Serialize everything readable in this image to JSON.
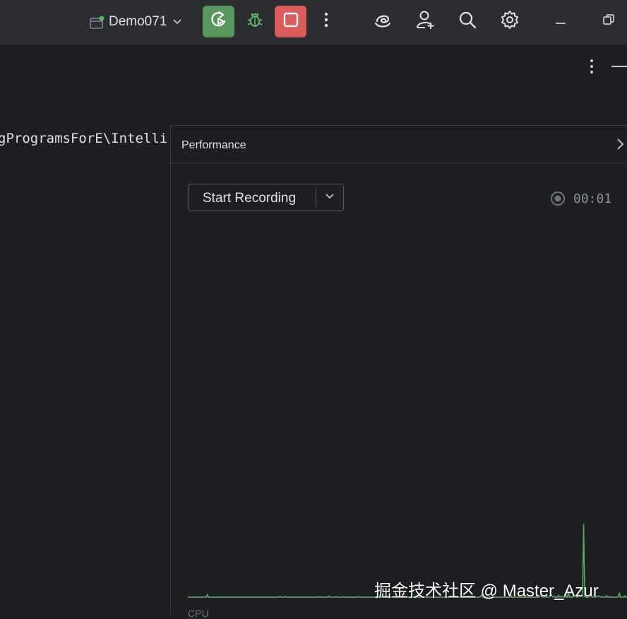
{
  "toolbar": {
    "project_name": "Demo071",
    "run_button": "run-icon",
    "debug_button": "debug-icon",
    "stop_button": "stop-icon",
    "more_button": "more-vertical-icon",
    "ai_assistant_button": "ai-assistant-icon",
    "add_user_button": "add-user-icon",
    "search_button": "search-icon",
    "settings_button": "gear-icon",
    "colors": {
      "bar_bg": "#2b2d30",
      "run_bg": "#57965c",
      "stop_bg": "#db5c5c",
      "debug_color": "#5fb865"
    }
  },
  "editor": {
    "path_text": "gProgramsForE\\Intelli"
  },
  "performance": {
    "title": "Performance",
    "record_button": "Start Recording",
    "timer": "00:01",
    "cpu_label": "CPU"
  },
  "chart_data": {
    "type": "area",
    "series": [
      {
        "name": "CPU",
        "values": [
          1,
          1,
          1,
          1,
          1,
          1,
          1,
          1,
          1,
          1,
          1,
          1,
          1,
          1,
          1,
          1,
          1,
          1,
          5,
          1,
          1,
          1,
          1,
          1,
          1,
          1,
          1,
          1,
          1,
          1,
          1,
          1,
          1,
          1,
          1,
          1,
          1,
          1,
          1,
          1,
          1,
          1,
          1,
          1,
          1,
          1,
          1,
          1,
          1,
          1,
          1,
          1,
          1,
          1,
          1,
          1,
          1,
          1,
          1,
          1,
          1,
          1,
          1,
          1,
          1,
          1,
          1,
          1,
          1,
          1,
          1,
          1,
          1,
          1,
          1,
          1,
          1,
          1,
          1,
          1,
          1,
          1,
          1,
          1,
          1,
          2,
          1,
          1,
          1,
          1,
          2,
          1,
          1,
          1,
          1,
          1,
          1,
          1,
          1,
          1,
          1,
          1,
          1,
          1,
          1,
          1,
          1,
          1,
          1,
          1,
          1,
          1,
          1,
          1,
          1,
          1,
          1,
          1,
          1,
          1,
          1,
          1,
          2,
          1,
          1,
          1,
          1,
          1,
          1,
          1,
          3,
          1,
          1,
          1,
          1,
          1,
          1,
          2,
          1,
          1,
          1,
          1,
          1,
          1,
          2,
          1,
          1,
          1,
          1,
          1,
          1,
          1,
          1,
          1,
          1,
          1,
          1,
          2,
          1,
          1,
          1,
          1,
          1,
          1,
          1,
          1,
          1,
          1,
          1,
          1,
          1,
          1,
          1,
          1,
          1,
          1,
          1,
          1,
          1,
          2,
          1,
          1,
          1,
          1,
          1,
          1,
          1,
          1,
          1,
          1,
          1,
          1,
          1,
          1,
          1,
          1,
          1,
          1,
          1,
          1,
          1,
          1,
          1,
          1,
          1,
          1,
          1,
          1,
          1,
          1,
          1,
          1,
          1,
          1,
          1,
          1,
          1,
          1,
          1,
          1,
          1,
          2,
          1,
          1,
          1,
          1,
          1,
          1,
          1,
          1,
          1,
          1,
          1,
          1,
          1,
          1,
          1,
          1,
          1,
          1,
          1,
          1,
          1,
          1,
          1,
          1,
          1,
          1,
          1,
          1,
          1,
          1,
          2,
          1,
          1,
          1,
          1,
          1,
          1,
          1,
          1,
          1,
          1,
          1,
          1,
          1,
          1,
          1,
          1,
          1,
          2,
          5,
          1,
          1,
          1,
          1,
          1,
          1,
          1,
          1,
          1,
          2,
          1,
          1,
          1,
          1,
          1,
          1,
          1,
          1,
          1,
          1,
          1,
          1,
          1,
          1,
          1,
          1,
          4,
          1,
          1,
          1,
          1,
          1,
          1,
          1,
          1,
          1,
          1,
          1,
          1,
          1,
          1,
          1,
          1,
          1,
          1,
          1,
          1,
          1,
          1,
          1,
          1,
          1,
          2,
          3,
          2,
          1,
          1,
          2,
          1,
          2,
          1,
          1,
          3,
          5,
          2,
          2,
          2,
          1,
          1,
          1,
          4,
          1,
          2,
          2,
          1,
          1,
          1,
          2,
          1,
          8,
          1,
          2,
          1,
          1,
          3,
          3,
          2,
          1,
          2,
          4,
          2,
          3,
          7,
          112,
          2,
          1,
          1,
          1,
          2,
          4,
          3,
          1,
          1,
          3,
          1,
          2,
          2,
          3,
          2,
          1,
          2,
          1,
          1,
          1,
          3,
          1,
          2,
          1,
          1,
          1,
          1,
          1,
          1,
          1,
          1,
          2,
          7,
          1,
          1,
          1,
          1,
          3,
          1,
          1
        ],
        "color": "#5fa863"
      }
    ],
    "ylim": [
      0,
      120
    ]
  }
}
